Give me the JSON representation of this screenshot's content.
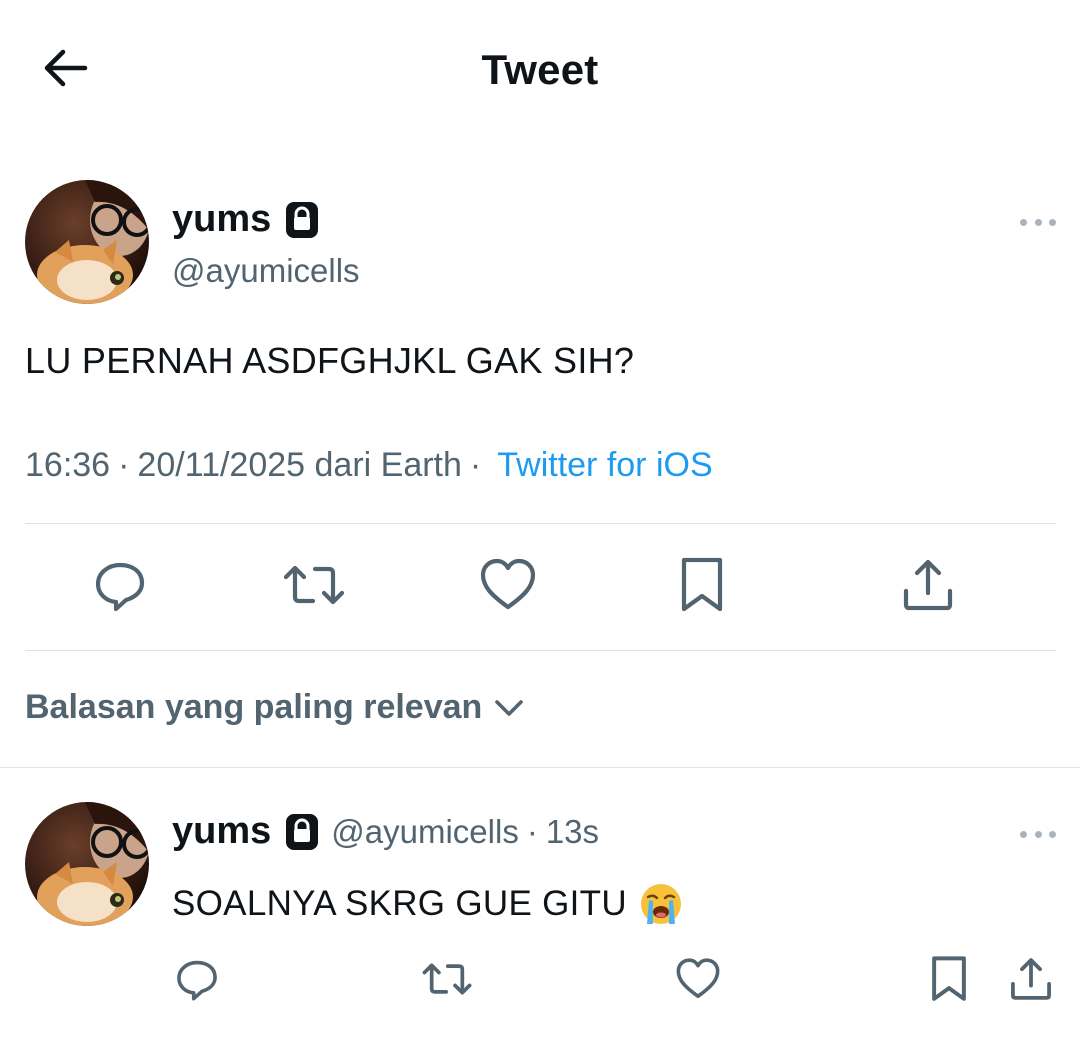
{
  "header": {
    "title": "Tweet",
    "back_icon": "arrow-left-icon"
  },
  "tweet": {
    "author": {
      "name": "yums",
      "handle": "@ayumicells",
      "protected_icon": "lock-icon"
    },
    "text": "LU PERNAH ASDFGHJKL GAK SIH?",
    "meta": {
      "time": "16:36",
      "separator": "·",
      "date_location": "20/11/2025 dari Earth",
      "source": "Twitter for iOS"
    },
    "actions": [
      {
        "name": "reply",
        "icon": "reply-icon"
      },
      {
        "name": "retweet",
        "icon": "retweet-icon"
      },
      {
        "name": "like",
        "icon": "heart-icon"
      },
      {
        "name": "bookmark",
        "icon": "bookmark-icon"
      },
      {
        "name": "share",
        "icon": "share-icon"
      }
    ]
  },
  "replies_sort": {
    "label": "Balasan yang paling relevan",
    "icon": "chevron-down-icon"
  },
  "reply": {
    "author": {
      "name": "yums",
      "handle": "@ayumicells",
      "separator": "·",
      "time": "13s"
    },
    "text": "SOALNYA SKRG GUE GITU",
    "emoji": "loudly-crying-face"
  },
  "colors": {
    "text_primary": "#0f1419",
    "text_secondary": "#536471",
    "link": "#1d9bf0",
    "divider": "#dde3e8",
    "icon": "#536471"
  }
}
